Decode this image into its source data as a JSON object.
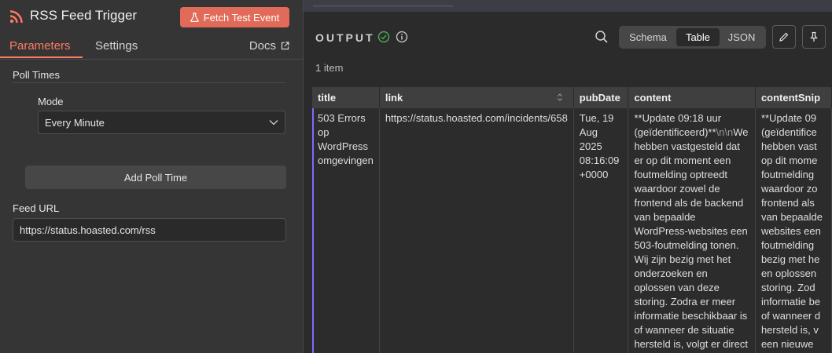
{
  "header": {
    "title": "RSS Feed Trigger",
    "fetch_button": "Fetch Test Event"
  },
  "tabs": {
    "parameters": "Parameters",
    "settings": "Settings",
    "docs": "Docs"
  },
  "poll_times": {
    "section_label": "Poll Times",
    "mode_label": "Mode",
    "mode_value": "Every Minute",
    "add_button": "Add Poll Time"
  },
  "feed": {
    "label": "Feed URL",
    "value": "https://status.hoasted.com/rss"
  },
  "output": {
    "label": "OUTPUT",
    "item_count": "1 item",
    "views": {
      "schema": "Schema",
      "table": "Table",
      "json": "JSON"
    }
  },
  "table": {
    "columns": [
      "title",
      "link",
      "pubDate",
      "content",
      "contentSnip"
    ],
    "row": {
      "title": "503 Errors op WordPress omgevingen",
      "link": "https://status.hoasted.com/incidents/658",
      "pubDate": "Tue, 19 Aug 2025 08:16:09 +0000",
      "content_pre": "**Update 09:18 uur (geïdentificeerd)**",
      "content_esc": "\\n\\n",
      "content_post": "We hebben vastgesteld dat er op dit moment een foutmelding optreedt waardoor zowel de frontend als de backend van bepaalde WordPress-websites een 503-foutmelding tonen. Wij zijn bezig met het onderzoeken en oplossen van deze storing. Zodra er meer informatie beschikbaar is of wanneer de situatie hersteld is, volgt er direct een nieuwe update.",
      "snippet_lines": [
        "**Update 09",
        "(geïdentifice",
        "hebben vast",
        "op dit mome",
        "foutmelding",
        "waardoor zo",
        "frontend als",
        "van bepaalde",
        "websites een",
        "foutmelding",
        "bezig met he",
        "en oplossen",
        "storing. Zod",
        "informatie be",
        "of wanneer d",
        "hersteld is, v",
        "een nieuwe"
      ]
    }
  },
  "colors": {
    "accent": "#ff7a63",
    "fetch_button": "#e26a59",
    "success": "#4caf50",
    "row_marker": "#7b6cff"
  },
  "icons": [
    "rss-icon",
    "flask-icon",
    "external-link-icon",
    "chevron-down-icon",
    "check-circle-icon",
    "info-icon",
    "search-icon",
    "pencil-icon",
    "pin-icon",
    "sort-icon"
  ]
}
